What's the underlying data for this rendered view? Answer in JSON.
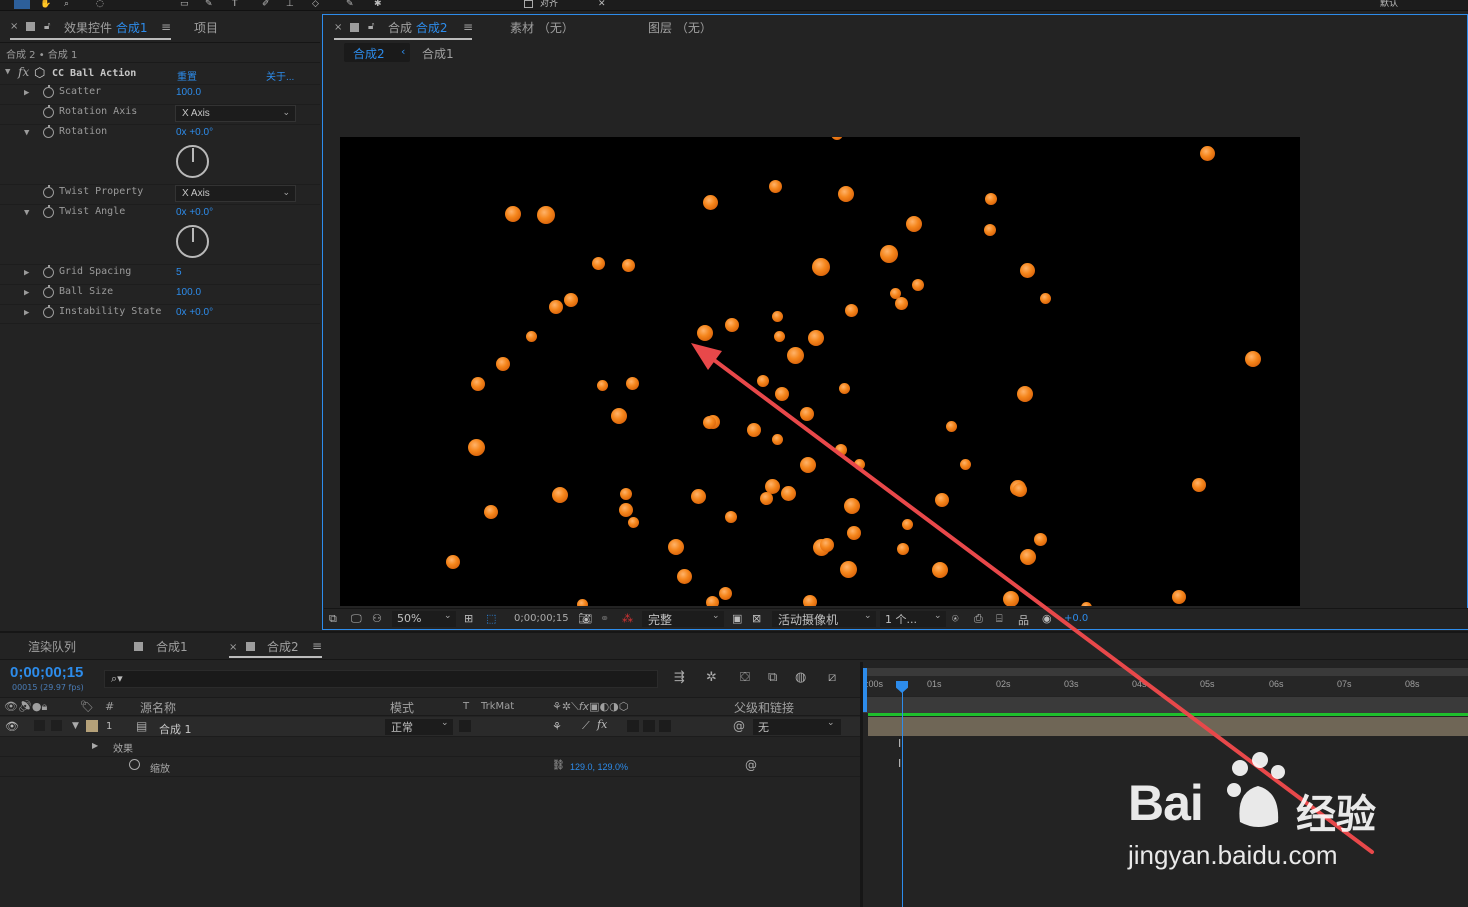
{
  "topbar": {
    "align_label": "对齐",
    "right_label": "默认"
  },
  "effect_controls": {
    "tab_close": "×",
    "tab_label": "效果控件",
    "tab_comp": "合成1",
    "tab_menu": "≡",
    "project_tab": "项目",
    "breadcrumb": "合成 2 • 合成 1",
    "effect_name": "CC Ball Action",
    "reset": "重置",
    "about": "关于...",
    "props": [
      {
        "name": "Scatter",
        "value": "100.0"
      },
      {
        "name": "Rotation Axis",
        "value": "X Axis"
      },
      {
        "name": "Rotation",
        "value": "0x +0.0°"
      },
      {
        "name": "Twist Property",
        "value": "X Axis"
      },
      {
        "name": "Twist Angle",
        "value": "0x +0.0°"
      },
      {
        "name": "Grid Spacing",
        "value": "5"
      },
      {
        "name": "Ball Size",
        "value": "100.0"
      },
      {
        "name": "Instability State",
        "value": "0x +0.0°"
      }
    ]
  },
  "composition_panel": {
    "tab_label": "合成",
    "tab_comp": "合成2",
    "tab_menu": "≡",
    "footage_tab": "素材 （无）",
    "layer_tab": "图层 （无）",
    "sub_tabs": [
      "合成2",
      "合成1"
    ]
  },
  "viewer_bar": {
    "zoom": "50%",
    "timecode": "0;00;00;15",
    "resolution": "完整",
    "camera": "活动摄像机",
    "views": "1 个...",
    "exposure": "+0.0"
  },
  "timeline": {
    "tabs": [
      "渲染队列",
      "合成1",
      "合成2"
    ],
    "tab_close": "×",
    "tab_menu": "≡",
    "timecode": "0;00;00;15",
    "frames": "00015 (29.97 fps)",
    "search_icon": "⌕▾",
    "columns": {
      "num": "#",
      "source": "源名称",
      "mode": "模式",
      "t": "T",
      "trkmat": "TrkMat",
      "parent": "父级和链接"
    },
    "layer": {
      "index": "1",
      "name": "合成 1",
      "mode": "正常",
      "parent": "无"
    },
    "effects_label": "效果",
    "scale_label": "缩放",
    "scale_value": "129.0, 129.0%",
    "ruler": [
      ":00s",
      "01s",
      "02s",
      "03s",
      "04s",
      "05s",
      "06s",
      "07s",
      "08s"
    ]
  },
  "watermark": {
    "brand": "Bai",
    "brand_cn": "经验",
    "url": "jingyan.baidu.com"
  },
  "colors": {
    "accent": "#2d8ceb",
    "ball": "#f5861c",
    "arrow": "#e8484a",
    "work_bar": "#1fbf2c",
    "layer_bar": "#6f6656"
  }
}
